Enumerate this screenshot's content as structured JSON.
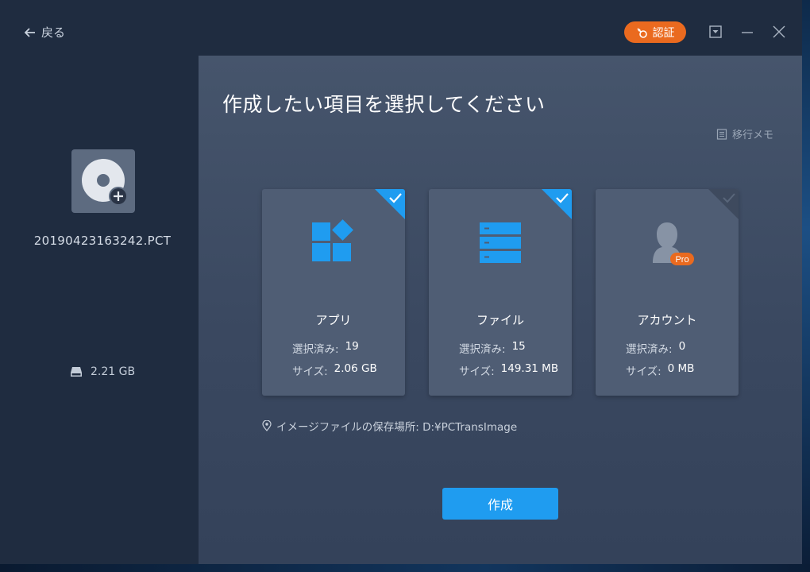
{
  "titlebar": {
    "back_label": "戻る",
    "auth_label": "認証",
    "colors": {
      "auth": "#ea6a1f"
    }
  },
  "sidebar": {
    "file_name": "20190423163242.PCT",
    "size": "2.21 GB",
    "icons": [
      "disk-image-icon",
      "plus-badge-icon",
      "drive-icon"
    ]
  },
  "main": {
    "title": "作成したい項目を選択してください",
    "memo_label": "移行メモ",
    "cards": [
      {
        "label": "アプリ",
        "selected_label": "選択済み:",
        "selected_value": "19",
        "size_label": "サイズ:",
        "size_value": "2.06 GB",
        "checked": true,
        "icon": "apps-icon"
      },
      {
        "label": "ファイル",
        "selected_label": "選択済み:",
        "selected_value": "15",
        "size_label": "サイズ:",
        "size_value": "149.31 MB",
        "checked": true,
        "icon": "files-icon"
      },
      {
        "label": "アカウント",
        "selected_label": "選択済み:",
        "selected_value": "0",
        "size_label": "サイズ:",
        "size_value": "0 MB",
        "checked": false,
        "icon": "account-icon",
        "badge": "Pro"
      }
    ],
    "path_text": "イメージファイルの保存場所: D:¥PCTransImage",
    "create_label": "作成",
    "colors": {
      "accent": "#1f9cf0",
      "card": "#4f5d74"
    }
  }
}
